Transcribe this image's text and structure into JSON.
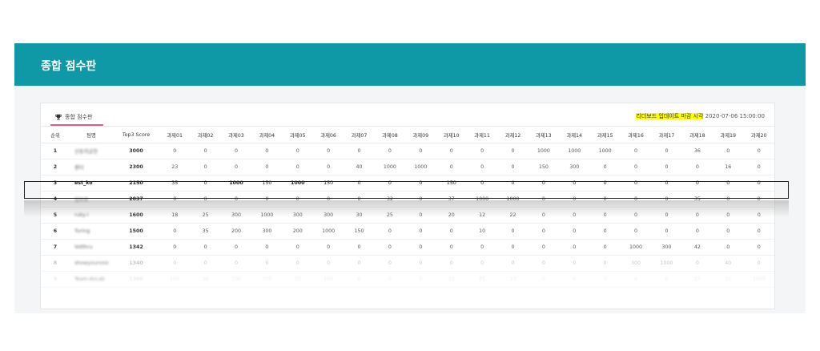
{
  "header": {
    "title": "종합 점수판"
  },
  "tab": {
    "label": "종합 점수판",
    "icon": "trophy-icon"
  },
  "deadline": {
    "label": "리더보드 업데이트 마감 시각",
    "datetime": "2020-07-06 15:00:00"
  },
  "table": {
    "columns": [
      "순위",
      "팀명",
      "Top3 Score",
      "과제01",
      "과제02",
      "과제03",
      "과제04",
      "과제05",
      "과제06",
      "과제07",
      "과제08",
      "과제09",
      "과제10",
      "과제11",
      "과제12",
      "과제13",
      "과제14",
      "과제15",
      "과제16",
      "과제17",
      "과제18",
      "과제19",
      "과제20"
    ],
    "rows": [
      {
        "rank": "1",
        "team": "신동의공헌",
        "top3": "3000",
        "scores": [
          "0",
          "0",
          "0",
          "0",
          "0",
          "0",
          "0",
          "0",
          "0",
          "0",
          "0",
          "0",
          "1000",
          "1000",
          "1000",
          "0",
          "0",
          "36",
          "0",
          "0"
        ]
      },
      {
        "rank": "2",
        "team": "퀀터",
        "top3": "2300",
        "scores": [
          "23",
          "0",
          "0",
          "0",
          "0",
          "0",
          "40",
          "1000",
          "1000",
          "0",
          "0",
          "0",
          "150",
          "300",
          "0",
          "0",
          "0",
          "0",
          "16",
          "0"
        ]
      },
      {
        "rank": "3",
        "team": "est_ko",
        "top3": "2150",
        "scores": [
          "35",
          "0",
          "1000",
          "150",
          "1000",
          "150",
          "0",
          "0",
          "0",
          "150",
          "0",
          "0",
          "0",
          "0",
          "0",
          "0",
          "0",
          "0",
          "0",
          "0"
        ]
      },
      {
        "rank": "4",
        "team": "딥브로",
        "top3": "2037",
        "scores": [
          "0",
          "0",
          "0",
          "0",
          "0",
          "0",
          "0",
          "32",
          "0",
          "37",
          "1000",
          "1000",
          "0",
          "0",
          "0",
          "0",
          "0",
          "35",
          "0",
          "0"
        ]
      },
      {
        "rank": "5",
        "team": "ruky-i",
        "top3": "1600",
        "scores": [
          "18",
          "25",
          "300",
          "1000",
          "300",
          "300",
          "30",
          "25",
          "0",
          "20",
          "12",
          "22",
          "0",
          "0",
          "0",
          "0",
          "0",
          "0",
          "0",
          "0"
        ]
      },
      {
        "rank": "6",
        "team": "Turing",
        "top3": "1500",
        "scores": [
          "0",
          "35",
          "200",
          "300",
          "200",
          "1000",
          "150",
          "0",
          "0",
          "0",
          "10",
          "0",
          "0",
          "0",
          "0",
          "0",
          "0",
          "0",
          "0",
          "0"
        ]
      },
      {
        "rank": "7",
        "team": "Volthru",
        "top3": "1342",
        "scores": [
          "0",
          "0",
          "0",
          "0",
          "0",
          "0",
          "0",
          "0",
          "0",
          "0",
          "0",
          "0",
          "0",
          "0",
          "0",
          "1000",
          "300",
          "42",
          "0",
          "0"
        ]
      },
      {
        "rank": "8",
        "team": "showyourvoic",
        "top3": "1340",
        "scores": [
          "0",
          "0",
          "0",
          "0",
          "0",
          "0",
          "0",
          "0",
          "0",
          "0",
          "0",
          "0",
          "0",
          "0",
          "0",
          "300",
          "1000",
          "0",
          "40",
          "0"
        ]
      },
      {
        "rank": "9",
        "team": "Team-AvLab",
        "top3": "1300",
        "scores": [
          "100",
          "36",
          "100",
          "300",
          "50",
          "100",
          "0",
          "0",
          "0",
          "22",
          "25",
          "33",
          "0",
          "0",
          "0",
          "0",
          "0",
          "27",
          "32",
          "1000"
        ]
      }
    ]
  }
}
